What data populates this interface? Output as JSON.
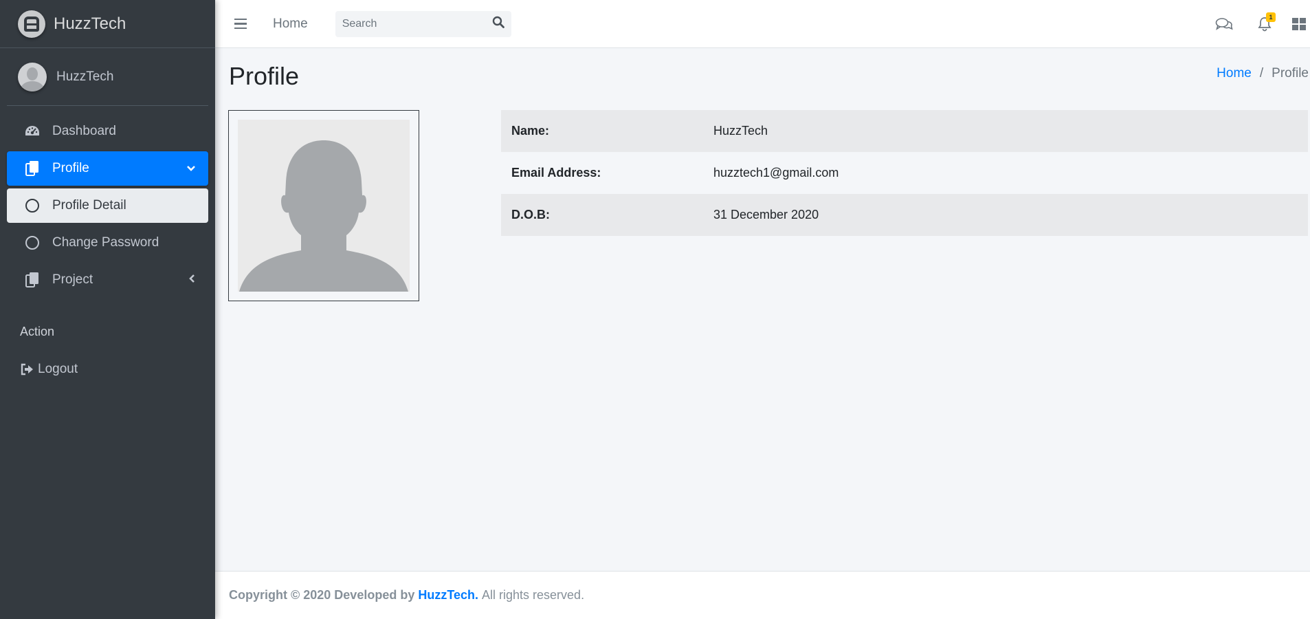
{
  "brand": {
    "name": "HuzzTech"
  },
  "user": {
    "name": "HuzzTech"
  },
  "sidebar": {
    "items": [
      {
        "label": "Dashboard",
        "icon": "tachometer-icon"
      },
      {
        "label": "Profile",
        "icon": "copy-icon",
        "active": true
      },
      {
        "label": "Profile Detail",
        "icon": "circle-icon"
      },
      {
        "label": "Change Password",
        "icon": "circle-icon"
      },
      {
        "label": "Project",
        "icon": "copy-icon"
      }
    ],
    "header": "Action",
    "logout": "Logout"
  },
  "topbar": {
    "home": "Home",
    "search_placeholder": "Search",
    "notification_count": "1"
  },
  "main": {
    "title": "Profile",
    "breadcrumb": {
      "home": "Home",
      "separator": "/",
      "current": "Profile"
    },
    "profile": [
      {
        "label": "Name:",
        "value": "HuzzTech"
      },
      {
        "label": "Email Address:",
        "value": "huzztech1@gmail.com"
      },
      {
        "label": "D.O.B:",
        "value": "31 December 2020"
      }
    ]
  },
  "footer": {
    "prefix": "Copyright © 2020 Developed by",
    "brand": "HuzzTech.",
    "suffix": "All rights reserved."
  },
  "colors": {
    "sidebar_bg": "#343a40",
    "accent": "#007bff",
    "badge": "#ffc107"
  }
}
